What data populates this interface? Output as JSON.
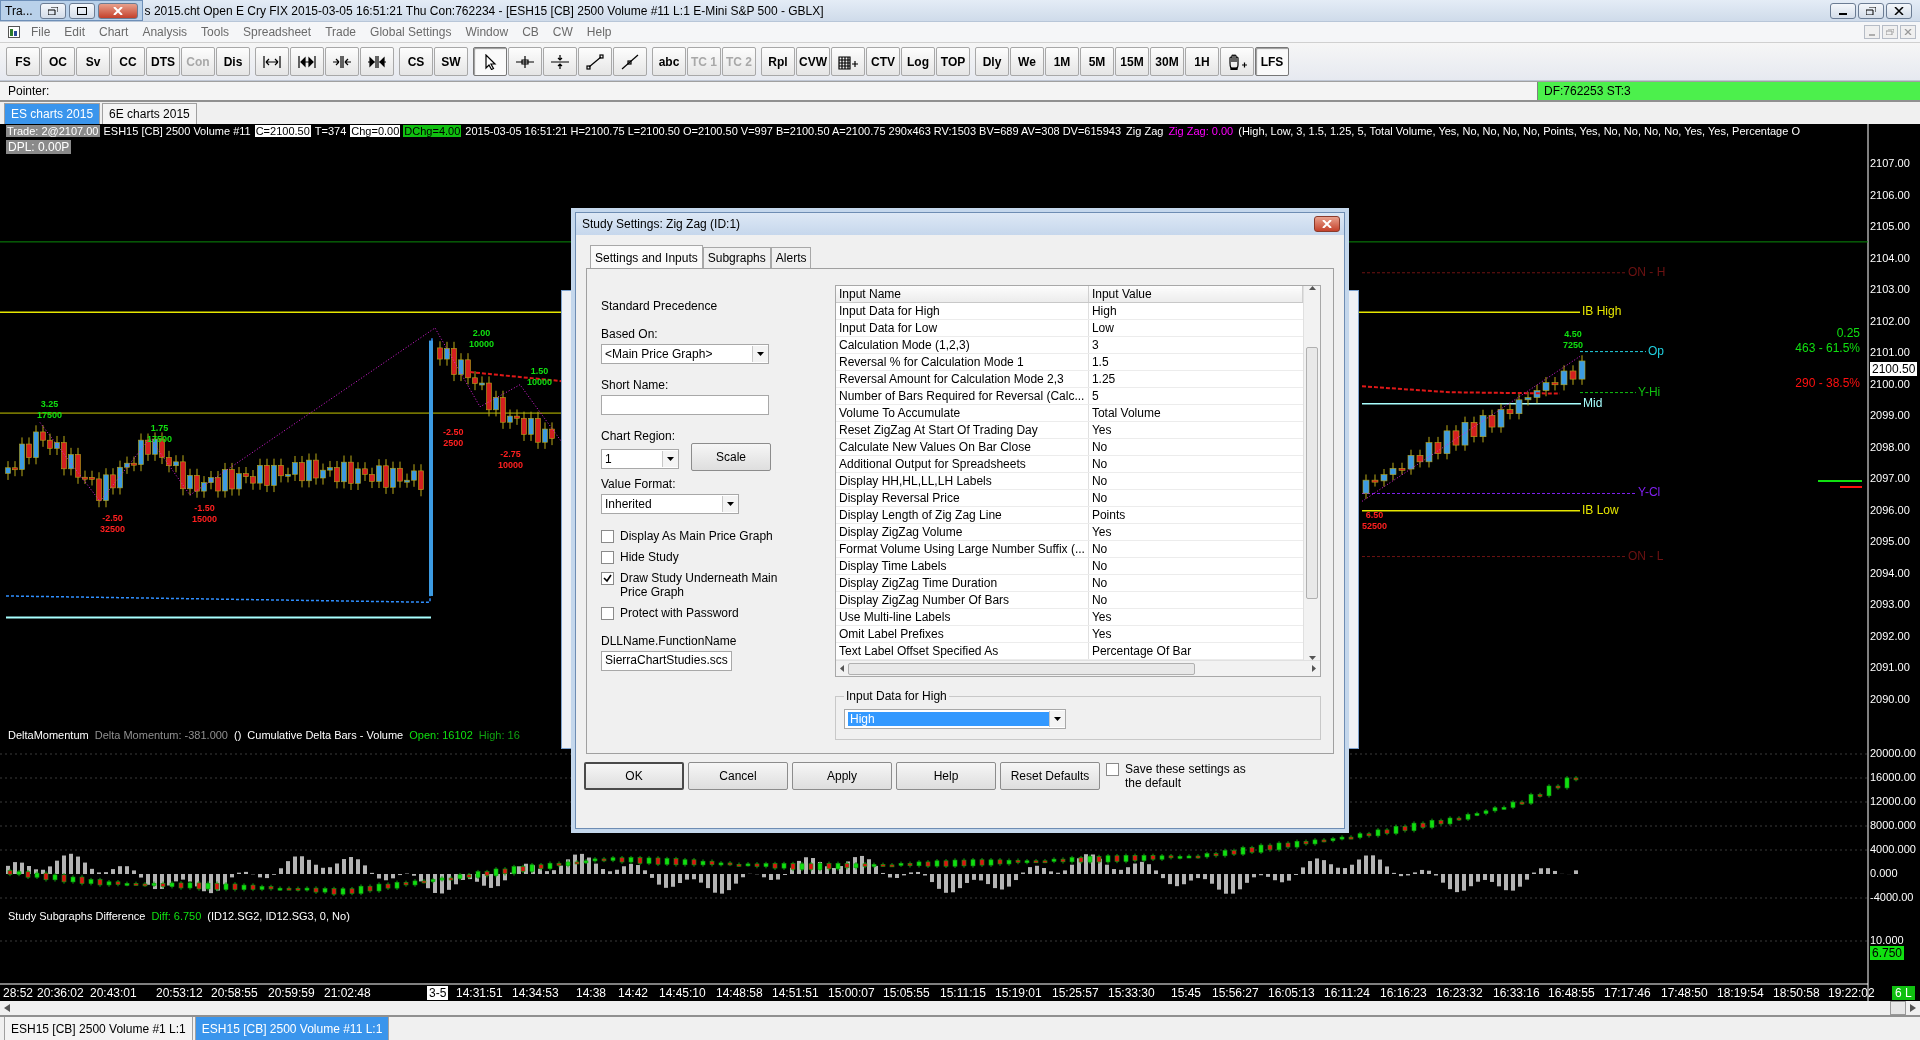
{
  "window": {
    "child_title": "Tra...",
    "title": "s 2015.cht  Open E Cry FIX 2015-03-05  16:51:21 Thu  Con:762234 - [ESH15 [CB]  2500 Volume  #11  L:1  E-Mini S&P 500 - GBLX]"
  },
  "menu": [
    "File",
    "Edit",
    "Chart",
    "Analysis",
    "Tools",
    "Spreadsheet",
    "Trade",
    "Global Settings",
    "Window",
    "CB",
    "CW",
    "Help"
  ],
  "toolbar": [
    {
      "kind": "text",
      "label": "FS",
      "selected": false,
      "disabled": false
    },
    {
      "kind": "text",
      "label": "OC",
      "selected": false,
      "disabled": false
    },
    {
      "kind": "text",
      "label": "Sv",
      "selected": false,
      "disabled": false
    },
    {
      "kind": "text",
      "label": "CC",
      "selected": false,
      "disabled": false
    },
    {
      "kind": "text",
      "label": "DTS",
      "selected": false,
      "disabled": false
    },
    {
      "kind": "text",
      "label": "Con",
      "selected": false,
      "disabled": true
    },
    {
      "kind": "text",
      "label": "Dis",
      "selected": false,
      "disabled": false
    },
    {
      "kind": "icon",
      "selected": false,
      "disabled": false
    },
    {
      "kind": "icon",
      "selected": false,
      "disabled": false
    },
    {
      "kind": "icon",
      "selected": false,
      "disabled": false
    },
    {
      "kind": "icon",
      "selected": false,
      "disabled": false
    },
    {
      "kind": "text",
      "label": "CS",
      "selected": false,
      "disabled": false
    },
    {
      "kind": "text",
      "label": "SW",
      "selected": false,
      "disabled": false
    },
    {
      "kind": "icon",
      "selected": true,
      "disabled": false
    },
    {
      "kind": "icon",
      "selected": false,
      "disabled": false
    },
    {
      "kind": "icon",
      "selected": false,
      "disabled": false
    },
    {
      "kind": "icon",
      "selected": false,
      "disabled": false
    },
    {
      "kind": "icon",
      "selected": false,
      "disabled": false
    },
    {
      "kind": "text",
      "label": "abc",
      "selected": false,
      "disabled": false
    },
    {
      "kind": "text",
      "label": "TC 1",
      "selected": false,
      "disabled": true
    },
    {
      "kind": "text",
      "label": "TC 2",
      "selected": false,
      "disabled": true
    },
    {
      "kind": "text",
      "label": "Rpl",
      "selected": false,
      "disabled": false
    },
    {
      "kind": "text",
      "label": "CVW",
      "selected": false,
      "disabled": false
    },
    {
      "kind": "icon",
      "selected": false,
      "disabled": false
    },
    {
      "kind": "text",
      "label": "CTV",
      "selected": false,
      "disabled": false
    },
    {
      "kind": "text",
      "label": "Log",
      "selected": false,
      "disabled": false
    },
    {
      "kind": "text",
      "label": "TOP",
      "selected": false,
      "disabled": false
    },
    {
      "kind": "text",
      "label": "Dly",
      "selected": false,
      "disabled": false
    },
    {
      "kind": "text",
      "label": "We",
      "selected": false,
      "disabled": false
    },
    {
      "kind": "text",
      "label": "1M",
      "selected": false,
      "disabled": false
    },
    {
      "kind": "text",
      "label": "5M",
      "selected": false,
      "disabled": false
    },
    {
      "kind": "text",
      "label": "15M",
      "selected": false,
      "disabled": false
    },
    {
      "kind": "text",
      "label": "30M",
      "selected": false,
      "disabled": false
    },
    {
      "kind": "text",
      "label": "1H",
      "selected": false,
      "disabled": false
    },
    {
      "kind": "icon",
      "selected": false,
      "disabled": false
    },
    {
      "kind": "text",
      "label": "LFS",
      "selected": true,
      "disabled": false
    }
  ],
  "pointer_bar": {
    "label": "Pointer:",
    "status": "DF:762253  ST:3"
  },
  "chartbook_tabs": [
    {
      "label": "ES charts 2015",
      "selected": true
    },
    {
      "label": "6E charts 2015",
      "selected": false
    }
  ],
  "chart": {
    "header": [
      {
        "text": "Trade: 2@2107.00",
        "kind": "grey"
      },
      {
        "text": "ESH15 [CB]  2500 Volume  #11",
        "kind": "plain"
      },
      {
        "text": "C=2100.50",
        "kind": "boxed"
      },
      {
        "text": "T=374",
        "kind": "plain"
      },
      {
        "text": "Chg=0.00",
        "kind": "boxed"
      },
      {
        "text": "DChg=4.00",
        "kind": "green"
      },
      {
        "text": "2015-03-05 16:51:21 H=2100.75 L=2100.50 O=2100.50 V=997 B=2100.50 A=2100.75 290x463 RV:1503 BV=689 AV=308 DV=615943",
        "kind": "plain"
      },
      {
        "text": "Zig Zag",
        "kind": "plain"
      },
      {
        "text": "Zig Zag: 0.00",
        "kind": "magenta"
      },
      {
        "text": "(High, Low, 3, 1.5, 1.25, 5, Total Volume, Yes, No, No, No, No, Points, Yes, No, No, No, No, Yes, Yes, Percentage O",
        "kind": "plain"
      }
    ],
    "header_line2": "DPL: 0.00P",
    "zigzag_labels": [
      {
        "value": "3.25",
        "volume": "17500",
        "kind": "up"
      },
      {
        "value": "1.75",
        "volume": "17500",
        "kind": "up"
      },
      {
        "value": "-2.50",
        "volume": "32500",
        "kind": "down"
      },
      {
        "value": "-1.50",
        "volume": "15000",
        "kind": "down"
      },
      {
        "value": "2.00",
        "volume": "10000",
        "kind": "up"
      },
      {
        "value": "1.50",
        "volume": "10000",
        "kind": "up"
      },
      {
        "value": "-2.50",
        "volume": "2500",
        "kind": "down"
      },
      {
        "value": "-2.75",
        "volume": "10000",
        "kind": "down"
      },
      {
        "value": "4.50",
        "volume": "7250",
        "kind": "up"
      },
      {
        "value": "6.50",
        "volume": "52500",
        "kind": "down"
      }
    ],
    "levels": [
      {
        "label": "ON - H",
        "color": "#6e1212"
      },
      {
        "label": "IB High",
        "color": "#e6e600"
      },
      {
        "label": "Op",
        "color": "#20d0e0"
      },
      {
        "label": "Y-Hi",
        "color": "#10c010"
      },
      {
        "label": "Mid",
        "color": "#a8ffff"
      },
      {
        "label": "Y-Cl",
        "color": "#8020f0"
      },
      {
        "label": "IB Low",
        "color": "#e6e600"
      },
      {
        "label": "ON - L",
        "color": "#6e1212"
      }
    ],
    "side_labels": [
      {
        "text": "0.25",
        "color": "#10e010"
      },
      {
        "text": "463 - 61.5%",
        "color": "#10e010"
      },
      {
        "text": "290 - 38.5%",
        "color": "#ff1010"
      }
    ],
    "price_axis": [
      "2107.00",
      "2106.00",
      "2105.00",
      "2104.00",
      "2103.00",
      "2102.00",
      "2101.00",
      "2100.00",
      "2099.00",
      "2098.00",
      "2097.00",
      "2096.00",
      "2095.00",
      "2094.00",
      "2093.00",
      "2092.00",
      "2091.00",
      "2090.00"
    ],
    "last_price": "2100.50",
    "lower_axis": [
      "20000.00",
      "16000.00",
      "12000.00",
      "8000.000",
      "4000.000",
      "0.000",
      "-4000.00",
      "10.000"
    ],
    "diff_value": "6.750",
    "delta_legend": [
      {
        "text": "DeltaMomentum",
        "kind": "plain"
      },
      {
        "text": "Delta Momentum: -381.000",
        "kind": "muted"
      },
      {
        "text": "()",
        "kind": "plain"
      },
      {
        "text": "Cumulative Delta Bars - Volume",
        "kind": "plain"
      },
      {
        "text": "Open: 16102",
        "kind": "green"
      },
      {
        "text": "High: 16",
        "kind": "dark-green"
      }
    ],
    "subgraph_legend": [
      {
        "text": "Study Subgraphs Difference",
        "kind": "plain"
      },
      {
        "text": "Diff: 6.750",
        "kind": "green"
      },
      {
        "text": "(ID12.SG2, ID12.SG3, 0, No)",
        "kind": "plain"
      }
    ],
    "time_axis": [
      {
        "text": "28:52",
        "kind": "time"
      },
      {
        "text": "20:36:02",
        "kind": "time"
      },
      {
        "text": "20:43:01",
        "kind": "time"
      },
      {
        "text": "20:53:12",
        "kind": "time"
      },
      {
        "text": "20:58:55",
        "kind": "time"
      },
      {
        "text": "20:59:59",
        "kind": "time"
      },
      {
        "text": "21:02:48",
        "kind": "time"
      },
      {
        "text": "3-5",
        "kind": "date"
      },
      {
        "text": "14:31:51",
        "kind": "time"
      },
      {
        "text": "14:34:53",
        "kind": "time"
      },
      {
        "text": "14:38",
        "kind": "time"
      },
      {
        "text": "14:42",
        "kind": "time"
      },
      {
        "text": "14:45:10",
        "kind": "time"
      },
      {
        "text": "14:48:58",
        "kind": "time"
      },
      {
        "text": "14:51:51",
        "kind": "time"
      },
      {
        "text": "15:00:07",
        "kind": "time"
      },
      {
        "text": "15:05:55",
        "kind": "time"
      },
      {
        "text": "15:11:15",
        "kind": "time"
      },
      {
        "text": "15:19:01",
        "kind": "time"
      },
      {
        "text": "15:25:57",
        "kind": "time"
      },
      {
        "text": "15:33:30",
        "kind": "time"
      },
      {
        "text": "15:45",
        "kind": "time"
      },
      {
        "text": "15:56:27",
        "kind": "time"
      },
      {
        "text": "16:05:13",
        "kind": "time"
      },
      {
        "text": "16:11:24",
        "kind": "time"
      },
      {
        "text": "16:16:23",
        "kind": "time"
      },
      {
        "text": "16:23:32",
        "kind": "time"
      },
      {
        "text": "16:33:16",
        "kind": "time"
      },
      {
        "text": "16:48:55",
        "kind": "time"
      },
      {
        "text": "17:17:46",
        "kind": "time"
      },
      {
        "text": "17:48:50",
        "kind": "time"
      },
      {
        "text": "18:19:54",
        "kind": "time"
      },
      {
        "text": "18:50:58",
        "kind": "time"
      },
      {
        "text": "19:22:02",
        "kind": "time"
      }
    ],
    "status_badge": "6 L"
  },
  "bottom_tabs": [
    {
      "label": "ESH15 [CB]  2500 Volume  #1  L:1",
      "selected": false
    },
    {
      "label": "ESH15 [CB]  2500 Volume  #11  L:1",
      "selected": true
    }
  ],
  "dialog": {
    "title": "Study Settings: Zig Zag (ID:1)",
    "tabs": [
      {
        "label": "Settings and Inputs",
        "selected": true
      },
      {
        "label": "Subgraphs",
        "selected": false
      },
      {
        "label": "Alerts",
        "selected": false
      }
    ],
    "precedence": "Standard Precedence",
    "based_on": {
      "label": "Based On:",
      "value": "<Main Price Graph>"
    },
    "short_name": {
      "label": "Short Name:"
    },
    "chart_region": {
      "label": "Chart Region:",
      "value": "1"
    },
    "scale_button": "Scale",
    "value_format": {
      "label": "Value Format:",
      "value": "Inherited"
    },
    "options": [
      {
        "label": "Display As Main Price Graph",
        "checked": false
      },
      {
        "label": "Hide Study",
        "checked": false
      },
      {
        "label": "Draw Study Underneath Main Price Graph",
        "checked": true
      },
      {
        "label": "Protect with Password",
        "checked": false
      }
    ],
    "dll": {
      "label": "DLLName.FunctionName",
      "value": "SierraChartStudies.scs"
    },
    "inputs": {
      "columns": [
        "Input Name",
        "Input Value"
      ],
      "rows": [
        {
          "name": "Input Data for High",
          "value": "High"
        },
        {
          "name": "Input Data for Low",
          "value": "Low"
        },
        {
          "name": "Calculation Mode (1,2,3)",
          "value": "3"
        },
        {
          "name": "Reversal % for Calculation Mode 1",
          "value": "1.5"
        },
        {
          "name": "Reversal Amount for Calculation Mode 2,3",
          "value": "1.25"
        },
        {
          "name": "Number of Bars Required for Reversal (Calc...",
          "value": "5"
        },
        {
          "name": "Volume To Accumulate",
          "value": "Total Volume"
        },
        {
          "name": "Reset ZigZag At Start Of Trading Day",
          "value": "Yes"
        },
        {
          "name": "Calculate New Values On Bar Close",
          "value": "No"
        },
        {
          "name": "Additional Output for Spreadsheets",
          "value": "No"
        },
        {
          "name": "Display HH,HL,LL,LH Labels",
          "value": "No"
        },
        {
          "name": "Display Reversal Price",
          "value": "No"
        },
        {
          "name": "Display Length of Zig Zag Line",
          "value": "Points"
        },
        {
          "name": "Display ZigZag Volume",
          "value": "Yes"
        },
        {
          "name": "Format Volume Using Large Number Suffix (...",
          "value": "No"
        },
        {
          "name": "Display Time Labels",
          "value": "No"
        },
        {
          "name": "Display ZigZag Time Duration",
          "value": "No"
        },
        {
          "name": "Display ZigZag Number Of Bars",
          "value": "No"
        },
        {
          "name": "Use Multi-line Labels",
          "value": "Yes"
        },
        {
          "name": "Omit Label Prefixes",
          "value": "Yes"
        },
        {
          "name": "Text Label Offset Specified As",
          "value": "Percentage Of Bar"
        }
      ]
    },
    "input_editor": {
      "label": "Input Data for High",
      "value": "High"
    },
    "buttons": [
      "OK",
      "Cancel",
      "Apply",
      "Help",
      "Reset Defaults"
    ],
    "save_default": {
      "label": "Save these settings as the default",
      "checked": false
    }
  }
}
